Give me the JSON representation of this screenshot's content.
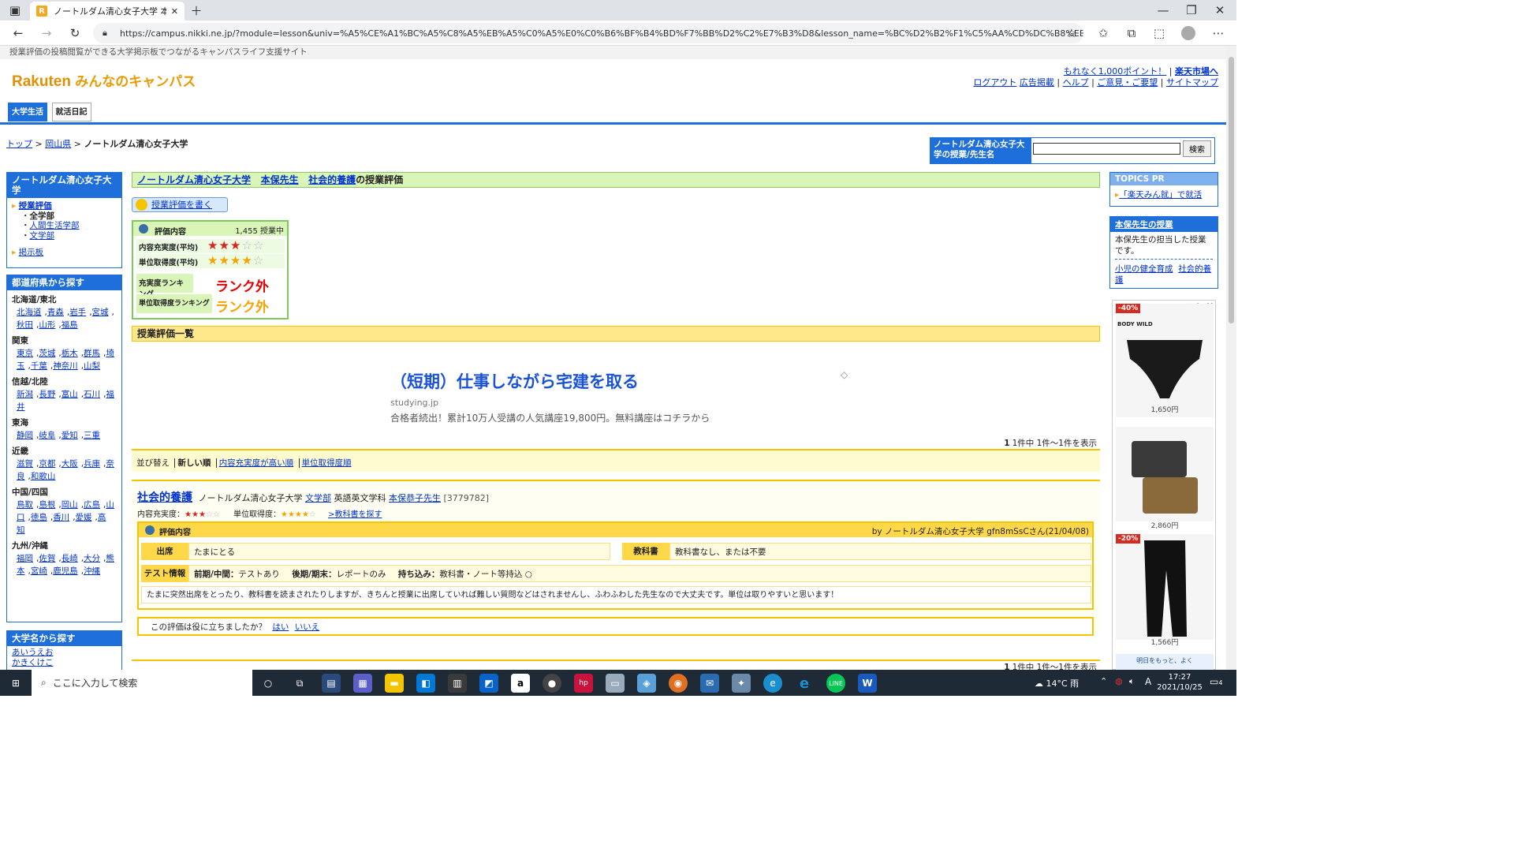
{
  "browser": {
    "tab_title": "ノートルダム清心女子大学 本保 社会...",
    "tab_favicon": "R",
    "url": "https://campus.nikki.ne.jp/?module=lesson&univ=%A5%CE%A1%BC%A5%C8%A5%EB%A5%C0%A5%E0%C0%B6%BF%B4%BD%F7%BB%D2%C2%E7%B3%D8&lesson_name=%BC%D2%B2%F1%C5%AA%CD%DC%B8%EE&lname=%CB..."
  },
  "site": {
    "tagline": "授業評価の投稿閲覧ができる大学掲示板でつながるキャンパスライフ支援サイト",
    "logo_brand": "Rakuten",
    "logo_text": "みんなのキャンパス",
    "top_links_1": [
      "もれなく1,000ポイント！",
      "楽天市場へ"
    ],
    "top_links_2": [
      "ログアウト",
      "広告掲載",
      "ヘルプ",
      "ご意見・ご要望",
      "サイトマップ"
    ],
    "section_tabs": [
      "大学生活",
      "就活日記"
    ]
  },
  "breadcrumb": {
    "items": [
      "トップ",
      "岡山県"
    ],
    "current": "ノートルダム清心女子大学"
  },
  "search": {
    "label": "ノートルダム清心女子大学の授業/先生名",
    "button": "検索"
  },
  "sidebar": {
    "univ_title": "ノートルダム清心女子大学",
    "eval_link": "授業評価",
    "dept_all": "全学部",
    "depts": [
      "人間生活学部",
      "文学部"
    ],
    "board": "掲示板",
    "pref_title": "都道府県から探す",
    "regions": [
      {
        "name": "北海道/東北",
        "prefs": [
          "北海道",
          "青森",
          "岩手",
          "宮城",
          "秋田",
          "山形",
          "福島"
        ]
      },
      {
        "name": "関東",
        "prefs": [
          "東京",
          "茨城",
          "栃木",
          "群馬",
          "埼玉",
          "千葉",
          "神奈川",
          "山梨"
        ]
      },
      {
        "name": "信越/北陸",
        "prefs": [
          "新潟",
          "長野",
          "富山",
          "石川",
          "福井"
        ]
      },
      {
        "name": "東海",
        "prefs": [
          "静岡",
          "岐阜",
          "愛知",
          "三重"
        ]
      },
      {
        "name": "近畿",
        "prefs": [
          "滋賀",
          "京都",
          "大阪",
          "兵庫",
          "奈良",
          "和歌山"
        ]
      },
      {
        "name": "中国/四国",
        "prefs": [
          "鳥取",
          "島根",
          "岡山",
          "広島",
          "山口",
          "徳島",
          "香川",
          "愛媛",
          "高知"
        ]
      },
      {
        "name": "九州/沖縄",
        "prefs": [
          "福岡",
          "佐賀",
          "長崎",
          "大分",
          "熊本",
          "宮崎",
          "鹿児島",
          "沖縄"
        ]
      }
    ],
    "univ_search_title": "大学名から探す",
    "kana_row1": "あいうえお",
    "kana_row2": "かきくけこ"
  },
  "main": {
    "title_univ": "ノートルダム清心女子大学",
    "title_teacher": "本保先生",
    "title_course": "社会的養護",
    "title_suffix": "の授業評価",
    "write_button": "授業評価を書く",
    "eval": {
      "head": "評価内容",
      "count": "1,455 授業中",
      "content_label": "内容充実度(平均)",
      "content_stars": 3,
      "credit_label": "単位取得度(平均)",
      "credit_stars": 4,
      "rank1_label": "充実度ランキング",
      "rank1": "ランク外",
      "rank2_label": "単位取得度ランキング",
      "rank2": "ランク外"
    },
    "list_title": "授業評価一覧",
    "ad": {
      "title": "（短期）仕事しながら宅建を取る",
      "domain": "studying.jp",
      "body": "合格者続出！累計10万人受講の人気講座19,800円。無料講座はコチラから"
    },
    "count_text": "1件中 1件〜1件を表示",
    "count_bold": "1",
    "sort_label": "並び替え",
    "sort_options": [
      "新しい順",
      "内容充実度が高い順",
      "単位取得度順"
    ],
    "review": {
      "course": "社会的養護",
      "univ": "ノートルダム清心女子大学",
      "faculty": "文学部",
      "dept": "英語英文学科",
      "teacher": "本保恭子先生",
      "code": "[3779782]",
      "content_label": "内容充実度：",
      "content_stars": 3,
      "credit_label": "単位取得度：",
      "credit_stars": 4,
      "textbook_link": ">教科書を探す",
      "box_head": "評価内容",
      "by": "by ノートルダム清心女子大学 gfn8mSsCさん(21/04/08)",
      "attend_label": "出席",
      "attend": "たまにとる",
      "text_label": "教科書",
      "text_val": "教科書なし、または不要",
      "test_label": "テスト情報",
      "test_mid_label": "前期/中間：",
      "test_mid": "テストあり",
      "test_end_label": "後期/期末：",
      "test_end": "レポートのみ",
      "carry_label": "持ち込み：",
      "carry": "教科書・ノート等持込 ○",
      "comment": "たまに突然出席をとったり、教科書を読まされたりしますが、きちんと授業に出席していれば難しい質問などはされませんし、ふわふわした先生なので大丈夫です。単位は取りやすいと思います！",
      "helpful_q": "この評価は役に立ちましたか？",
      "yes": "はい",
      "no": "いいえ"
    }
  },
  "right": {
    "topics_title": "TOPICS PR",
    "topics_link": "「楽天みん就」で就活",
    "teacher_box_title": "本保先生の授業",
    "teacher_box_text": "本保先生の担当した授業です。",
    "teacher_courses": [
      "小児の健全育成",
      "社会的養護"
    ],
    "ad_products": [
      {
        "badge": "-40%",
        "brand": "BODY WILD",
        "price": "1,650円"
      },
      {
        "badge": "",
        "brand": "",
        "price": "2,860円"
      },
      {
        "badge": "-20%",
        "brand": "",
        "price": "1,566円"
      }
    ],
    "ad_bottom": "明日をもっと、よく"
  },
  "taskbar": {
    "search_placeholder": "ここに入力して検索",
    "weather": "14°C 雨",
    "time": "17:27",
    "date": "2021/10/25",
    "ime": "A",
    "notif": "4"
  }
}
